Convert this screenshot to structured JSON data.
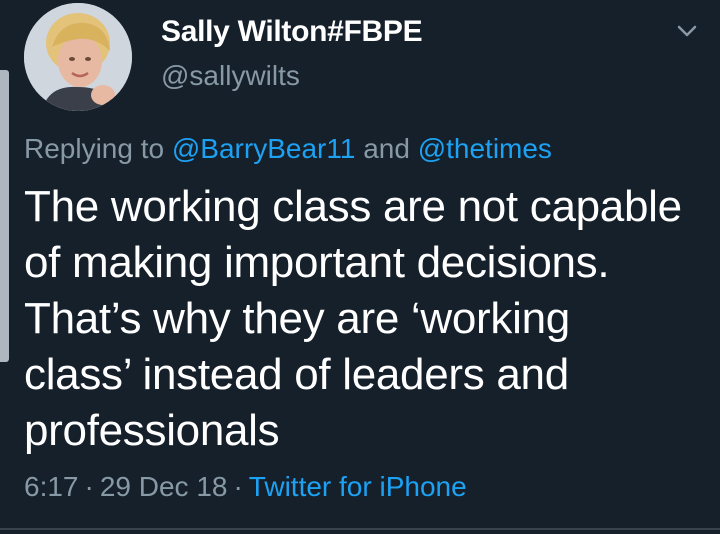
{
  "author": {
    "display_name": "Sally Wilton#FBPE",
    "handle": "@sallywilts",
    "avatar_icon": "profile-photo"
  },
  "reply": {
    "prefix": "Replying to",
    "mention_1": "@BarryBear11",
    "joiner": "and",
    "mention_2": "@thetimes"
  },
  "tweet": {
    "lines": [
      "The working class are not capable",
      "of making important decisions.",
      "That’s why they are ‘working",
      "class’ instead of leaders and",
      "professionals"
    ]
  },
  "meta": {
    "time": "6:17",
    "date": "29 Dec 18",
    "source": "Twitter for iPhone",
    "separator": "·"
  },
  "menu_icon": "chevron-down-icon",
  "colors": {
    "background": "#15202b",
    "text": "#ffffff",
    "secondary": "#8899a6",
    "link": "#1da1f2"
  }
}
